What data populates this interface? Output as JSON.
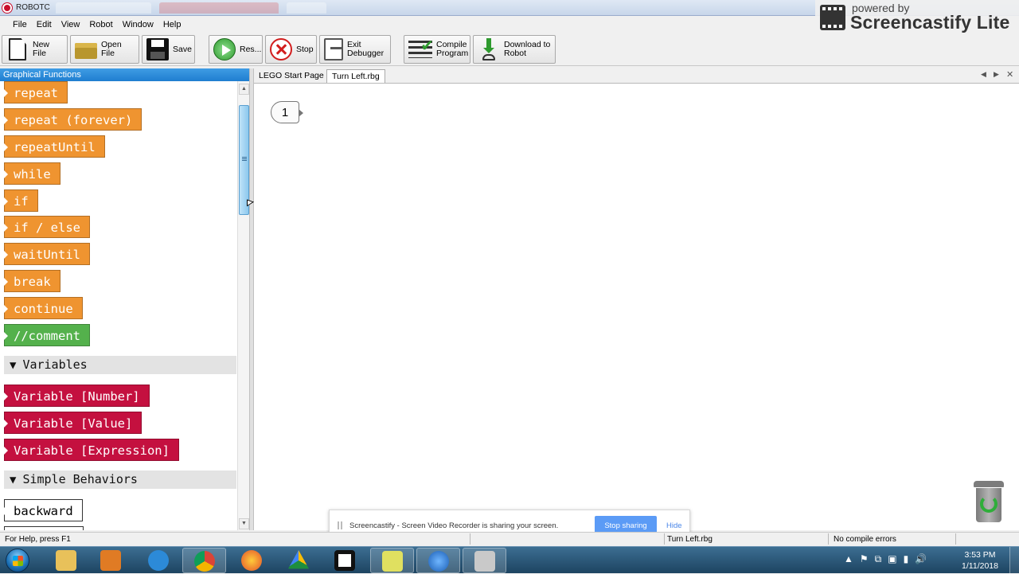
{
  "window": {
    "title": "ROBOTC"
  },
  "watermark": {
    "line1": "powered by",
    "line2": "Screencastify Lite"
  },
  "menu": [
    "File",
    "Edit",
    "View",
    "Robot",
    "Window",
    "Help"
  ],
  "toolbar": {
    "new_file": "New File",
    "open_file": "Open File",
    "save": "Save",
    "resume": "Res...",
    "stop": "Stop",
    "exit_debugger_1": "Exit",
    "exit_debugger_2": "Debugger",
    "compile_1": "Compile",
    "compile_2": "Program",
    "download_1": "Download to",
    "download_2": "Robot"
  },
  "palette": {
    "header": "Graphical Functions",
    "program_flow": [
      "repeat",
      "repeat (forever)",
      "repeatUntil",
      "while",
      "if",
      "if / else",
      "waitUntil",
      "break",
      "continue"
    ],
    "comment": "//comment",
    "variables_section": "Variables",
    "variables": [
      "Variable [Number]",
      "Variable [Value]",
      "Variable [Expression]"
    ],
    "simple_behaviors_section": "Simple Behaviors",
    "simple_behaviors": [
      "backward"
    ],
    "section_toggle": "▼"
  },
  "tabs": [
    "LEGO Start Page",
    "Turn Left.rbg"
  ],
  "tab_controls": {
    "left": "◀",
    "right": "▶",
    "close": "✕"
  },
  "canvas": {
    "line_number": "1"
  },
  "share_bar": {
    "message": "Screencastify - Screen Video Recorder is sharing your screen.",
    "stop": "Stop sharing",
    "hide": "Hide"
  },
  "status": {
    "help": "For Help, press F1",
    "file": "Turn Left.rbg",
    "compile": "No compile errors"
  },
  "clock": {
    "time": "3:53 PM",
    "date": "1/11/2018"
  },
  "tray_icons": [
    "▲",
    "⚑",
    "⧉",
    "▣",
    "▮",
    "🔊"
  ],
  "scroll_arrows": {
    "up": "▲",
    "down": "▼"
  }
}
